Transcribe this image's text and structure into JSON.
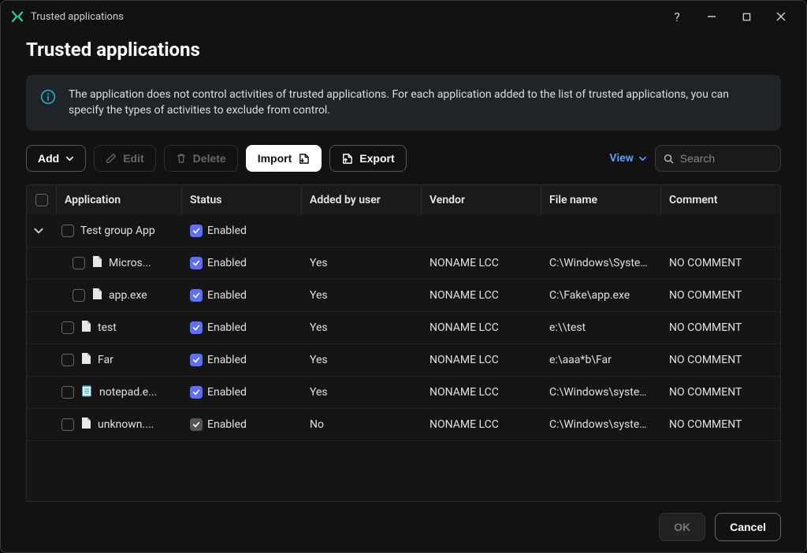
{
  "window": {
    "title": "Trusted applications"
  },
  "page": {
    "title": "Trusted applications",
    "info": "The application does not control activities of trusted applications. For each application added to the list of trusted applications, you can specify the types of activities to exclude from control."
  },
  "toolbar": {
    "add": "Add",
    "edit": "Edit",
    "delete": "Delete",
    "import": "Import",
    "export": "Export",
    "view": "View"
  },
  "search": {
    "placeholder": "Search",
    "value": ""
  },
  "columns": {
    "application": "Application",
    "status": "Status",
    "added_by_user": "Added by user",
    "vendor": "Vendor",
    "file_name": "File name",
    "comment": "Comment"
  },
  "group": {
    "name": "Test group App",
    "status": "Enabled"
  },
  "rows": [
    {
      "app": "Micros...",
      "status": "Enabled",
      "added": "Yes",
      "vendor": "NONAME LCC",
      "file": "C:\\Windows\\System...",
      "comment": "NO COMMENT",
      "indent": true,
      "icon": "file",
      "chk_gray": false
    },
    {
      "app": "app.exe",
      "status": "Enabled",
      "added": "Yes",
      "vendor": "NONAME LCC",
      "file": "C:\\Fake\\app.exe",
      "comment": "NO COMMENT",
      "indent": true,
      "icon": "file",
      "chk_gray": false
    },
    {
      "app": "test",
      "status": "Enabled",
      "added": "Yes",
      "vendor": "NONAME LCC",
      "file": "e:\\\\test",
      "comment": "NO COMMENT",
      "indent": false,
      "icon": "file",
      "chk_gray": false
    },
    {
      "app": "Far",
      "status": "Enabled",
      "added": "Yes",
      "vendor": "NONAME LCC",
      "file": "e:\\aaa*b\\Far",
      "comment": "NO COMMENT",
      "indent": false,
      "icon": "file",
      "chk_gray": false
    },
    {
      "app": "notepad.e...",
      "status": "Enabled",
      "added": "Yes",
      "vendor": "NONAME LCC",
      "file": "C:\\Windows\\system...",
      "comment": "NO COMMENT",
      "indent": false,
      "icon": "notepad",
      "chk_gray": false
    },
    {
      "app": "unknown....",
      "status": "Enabled",
      "added": "No",
      "vendor": "NONAME LCC",
      "file": "C:\\Windows\\system...",
      "comment": "NO COMMENT",
      "indent": false,
      "icon": "file",
      "chk_gray": true
    }
  ],
  "footer": {
    "ok": "OK",
    "cancel": "Cancel"
  }
}
